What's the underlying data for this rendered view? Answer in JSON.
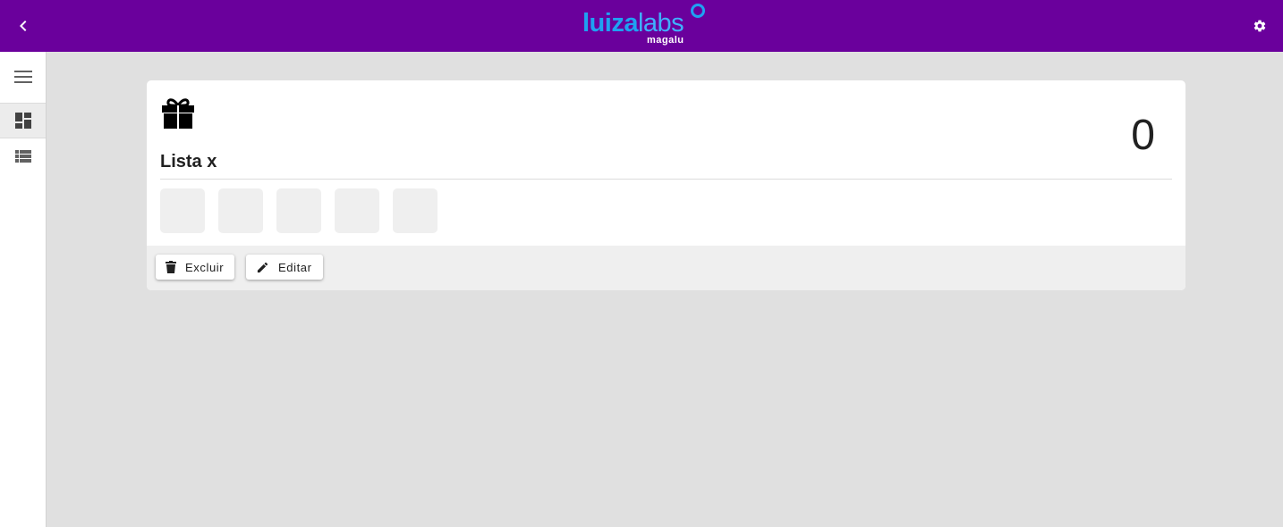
{
  "header": {
    "back_icon": "chevron-left-icon",
    "settings_icon": "gear-icon",
    "logo": {
      "main_bold": "luiza",
      "main_thin": "labs",
      "sub": "magalu"
    },
    "colors": {
      "bar": "#6a009c",
      "logo_blue": "#1fa1f2"
    }
  },
  "sidebar": {
    "items": [
      {
        "icon": "menu-icon"
      },
      {
        "icon": "dashboard-icon",
        "active": true
      },
      {
        "icon": "list-icon"
      }
    ]
  },
  "card": {
    "icon": "gift-icon",
    "title": "Lista x",
    "count": "0",
    "thumbnail_count": 5,
    "actions": {
      "delete_label": "Excluir",
      "delete_icon": "trash-icon",
      "edit_label": "Editar",
      "edit_icon": "pencil-icon"
    }
  }
}
